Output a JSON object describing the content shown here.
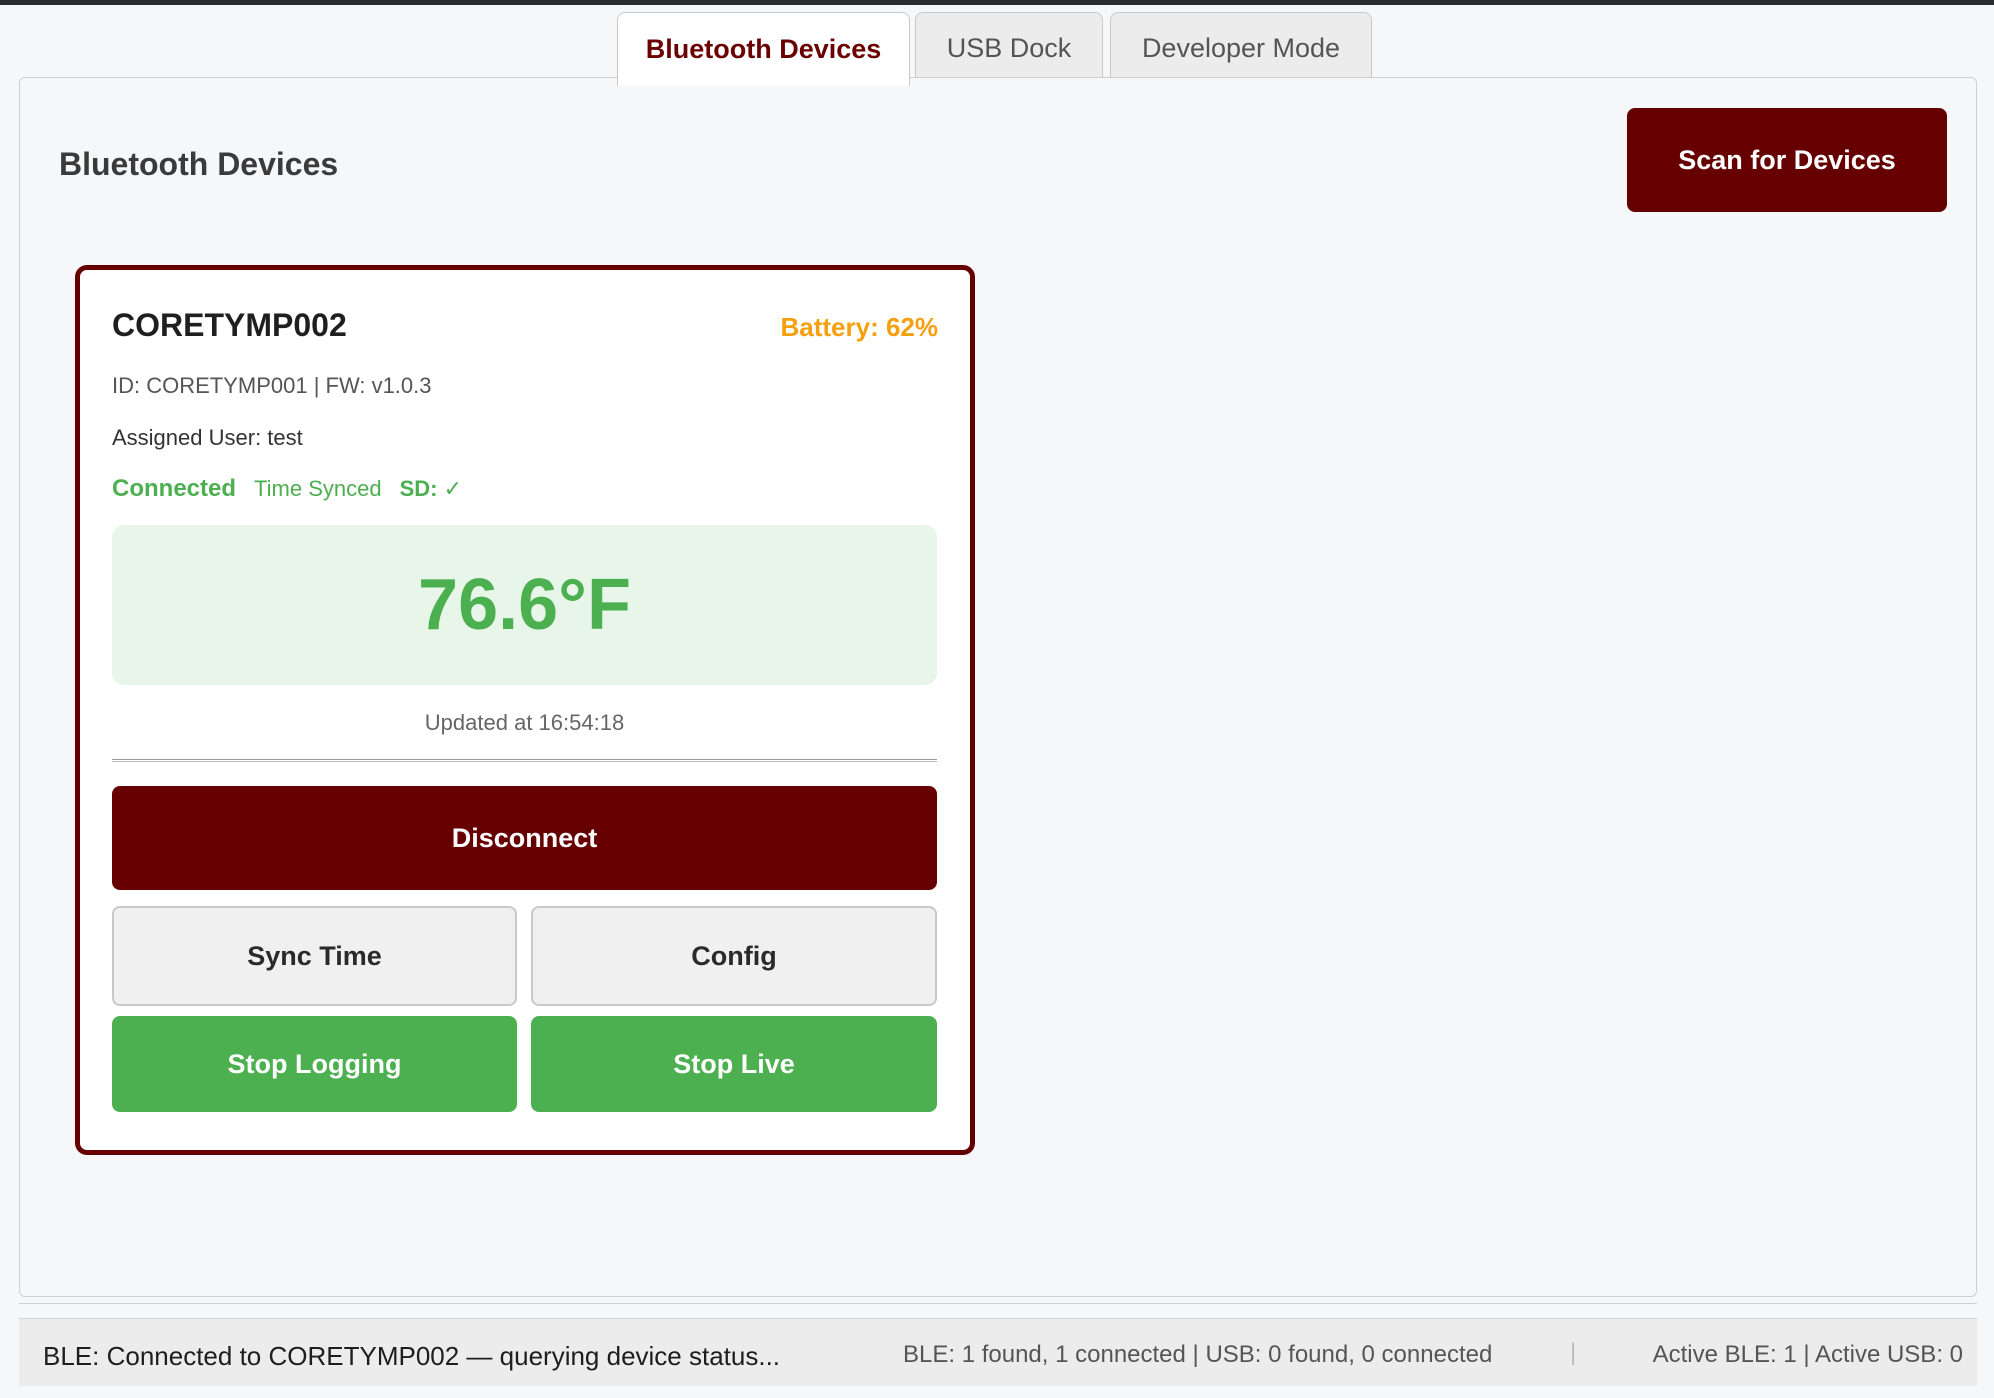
{
  "tabs": [
    {
      "label": "Bluetooth Devices",
      "active": true
    },
    {
      "label": "USB Dock",
      "active": false
    },
    {
      "label": "Developer Mode",
      "active": false
    }
  ],
  "panel": {
    "title": "Bluetooth Devices",
    "scan_button": "Scan for Devices"
  },
  "device": {
    "name": "CORETYMP002",
    "battery": "Battery: 62%",
    "id_line": "ID: CORETYMP001 | FW: v1.0.3",
    "assigned_user": "Assigned User: test",
    "status_connected": "Connected",
    "status_time": "Time Synced",
    "status_sd": "SD: ✓",
    "temperature": "76.6°F",
    "updated": "Updated at 16:54:18",
    "buttons": {
      "disconnect": "Disconnect",
      "sync_time": "Sync Time",
      "config": "Config",
      "stop_logging": "Stop Logging",
      "stop_live": "Stop Live"
    }
  },
  "statusbar": {
    "message": "BLE: Connected to CORETYMP002 — querying device status...",
    "counts": "BLE: 1 found, 1 connected | USB: 0 found, 0 connected",
    "separator": "|",
    "active": "Active BLE: 1 | Active USB: 0"
  },
  "colors": {
    "accent": "#660000",
    "success": "#4caf50",
    "battery": "#f5a00f",
    "temp_bg": "#e8f5e9"
  }
}
